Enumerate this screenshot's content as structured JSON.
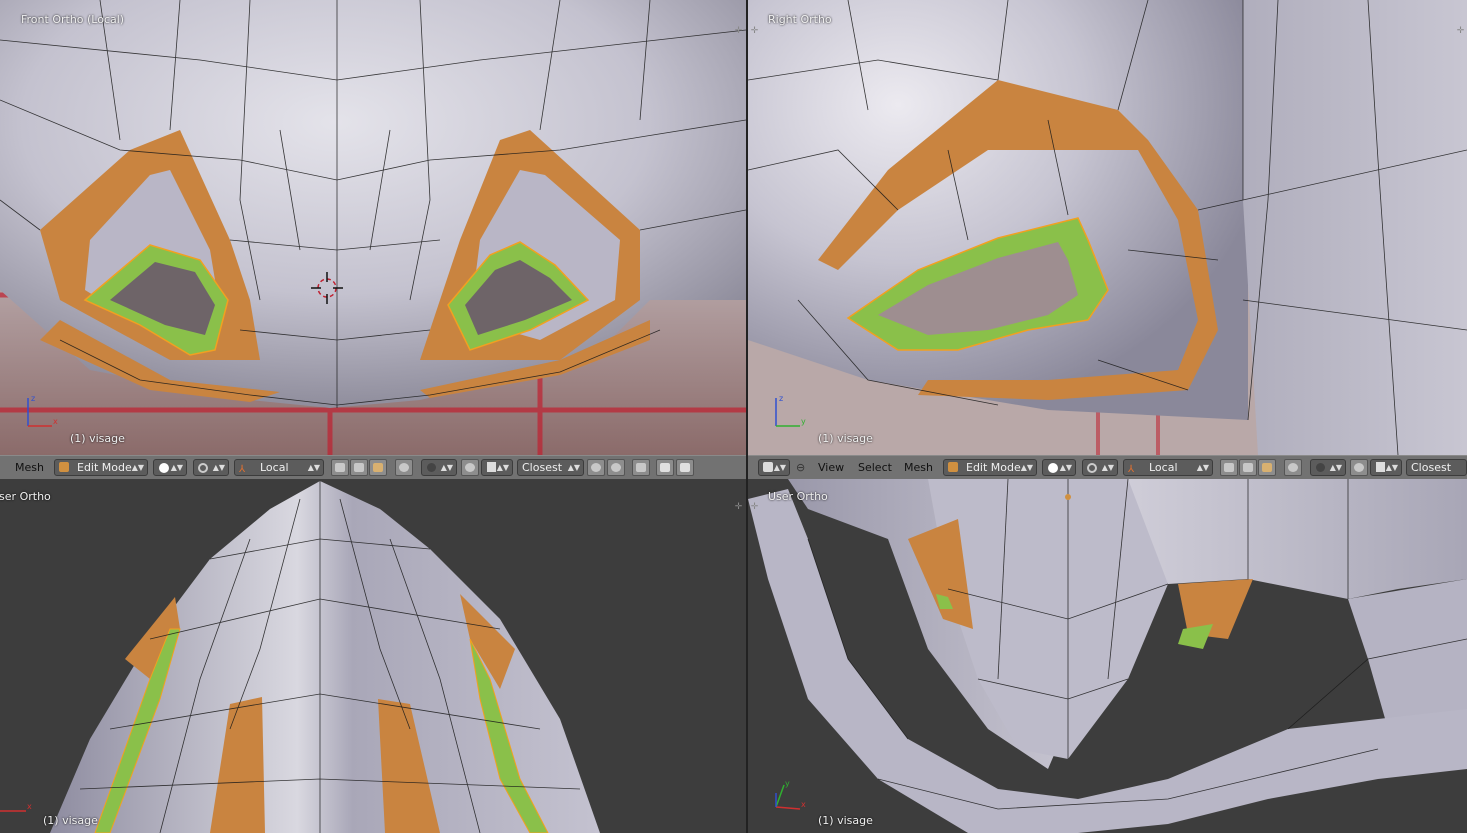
{
  "viewports": {
    "top_left": {
      "title": "Front Ortho (Local)",
      "object": "(1) visage"
    },
    "top_right": {
      "title": "Right Ortho",
      "object": "(1) visage"
    },
    "bottom_left": {
      "title": "User Ortho",
      "object": "(1) visage"
    },
    "bottom_right": {
      "title": "User Ortho",
      "object": "(1) visage"
    }
  },
  "header_left": {
    "mesh_menu": "Mesh",
    "mode": "Edit Mode",
    "orientation": "Local",
    "snap": "Closest"
  },
  "header_right": {
    "view_menu": "View",
    "select_menu": "Select",
    "mesh_menu": "Mesh",
    "mode": "Edit Mode",
    "orientation": "Local",
    "snap": "Closest"
  },
  "colors": {
    "mesh": "#b4b2c2",
    "selected_face": "#8ac04a",
    "seam_face": "#c98440",
    "edge": "#000000",
    "selected_edge": "#f2a020",
    "grid_red": "#c02030",
    "header_bg": "#727272"
  },
  "axes": {
    "front": [
      "z",
      "x"
    ],
    "right": [
      "z",
      "y"
    ],
    "user_left": [
      "x"
    ],
    "user_right": [
      "y",
      "x"
    ]
  }
}
